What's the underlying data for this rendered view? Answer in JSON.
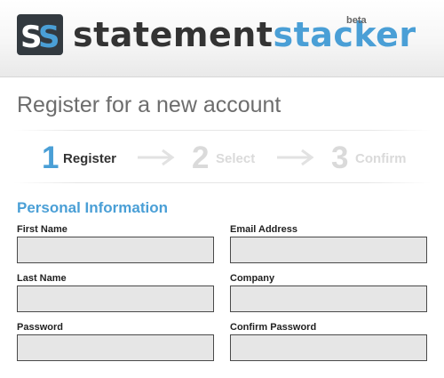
{
  "header": {
    "brand_part1": "statement",
    "brand_part2": "stacker",
    "badge": "beta",
    "logo_letters": "SS",
    "logo_icon": "ss-logo-icon"
  },
  "page_title": "Register for a new account",
  "steps": [
    {
      "number": "1",
      "label": "Register",
      "active": true
    },
    {
      "number": "2",
      "label": "Select",
      "active": false
    },
    {
      "number": "3",
      "label": "Confirm",
      "active": false
    }
  ],
  "section_title": "Personal Information",
  "fields": {
    "first_name": {
      "label": "First Name",
      "value": ""
    },
    "email": {
      "label": "Email Address",
      "value": ""
    },
    "last_name": {
      "label": "Last Name",
      "value": ""
    },
    "company": {
      "label": "Company",
      "value": ""
    },
    "password": {
      "label": "Password",
      "value": ""
    },
    "confirm_password": {
      "label": "Confirm Password",
      "value": ""
    }
  },
  "colors": {
    "accent": "#4a9fd6",
    "logo_dark": "#333a40",
    "inactive_step": "#dadada",
    "input_bg": "#e6e6e6"
  }
}
